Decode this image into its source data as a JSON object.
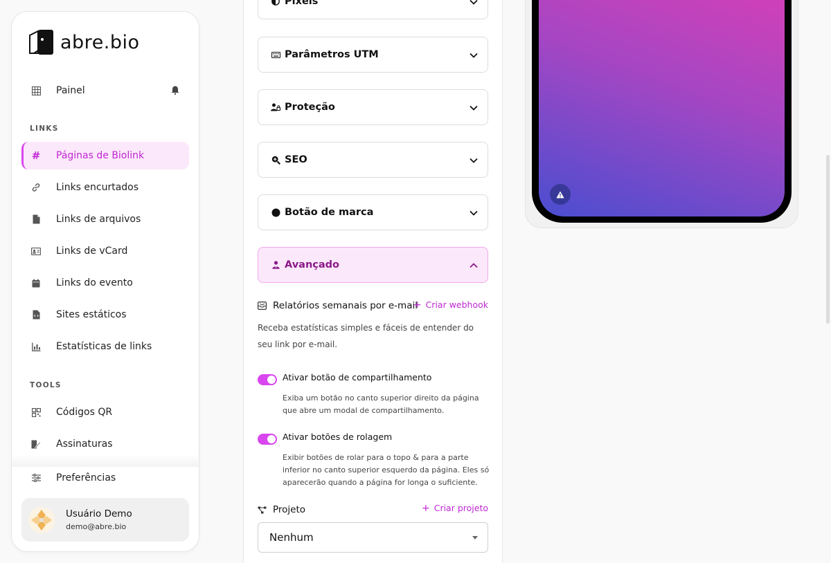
{
  "brand": {
    "name": "abre.bio",
    "accent": "#d946ef"
  },
  "sidebar": {
    "dashboard": {
      "label": "Painel",
      "icon": "grid-icon"
    },
    "sections": {
      "links": "LINKS",
      "tools": "TOOLS"
    },
    "links_items": [
      {
        "label": "Páginas de Biolink",
        "icon": "hash-icon",
        "active": true
      },
      {
        "label": "Links encurtados",
        "icon": "link-icon"
      },
      {
        "label": "Links de arquivos",
        "icon": "file-icon"
      },
      {
        "label": "Links de vCard",
        "icon": "id-card-icon"
      },
      {
        "label": "Links do evento",
        "icon": "calendar-icon"
      },
      {
        "label": "Sites estáticos",
        "icon": "code-file-icon"
      },
      {
        "label": "Estatísticas de links",
        "icon": "bar-chart-icon"
      }
    ],
    "tools_items": [
      {
        "label": "Códigos QR",
        "icon": "qr-icon"
      },
      {
        "label": "Assinaturas",
        "icon": "signature-icon"
      }
    ],
    "preferences": {
      "label": "Preferências",
      "icon": "sliders-icon"
    },
    "user": {
      "name": "Usuário Demo",
      "email": "demo@abre.bio"
    }
  },
  "form": {
    "accordions": [
      {
        "label": "Pixels",
        "icon": "half-circle-icon"
      },
      {
        "label": "Parâmetros UTM",
        "icon": "keyboard-icon"
      },
      {
        "label": "Proteção",
        "icon": "user-lock-icon"
      },
      {
        "label": "SEO",
        "icon": "search-plus-icon"
      },
      {
        "label": "Botão de marca",
        "icon": "circle-icon"
      },
      {
        "label": "Avançado",
        "icon": "user-tie-icon",
        "open": true
      }
    ],
    "weekly_reports": {
      "label": "Relatórios semanais por e-mail",
      "action": "Criar webhook",
      "description": "Receba estatísticas simples e fáceis de entender do seu link por e-mail."
    },
    "share_toggle": {
      "label": "Ativar botão de compartilhamento",
      "description": "Exiba um botão no canto superior direito da página que abre um modal de compartilhamento.",
      "on": true
    },
    "scroll_toggle": {
      "label": "Ativar botões de rolagem",
      "description": "Exibir botões de rolar para o topo & para a parte inferior no canto superior esquerdo da página. Eles só aparecerão quando a página for longa o suficiente.",
      "on": true
    },
    "project": {
      "label": "Projeto",
      "action": "Criar projeto",
      "selected": "Nenhum"
    }
  }
}
